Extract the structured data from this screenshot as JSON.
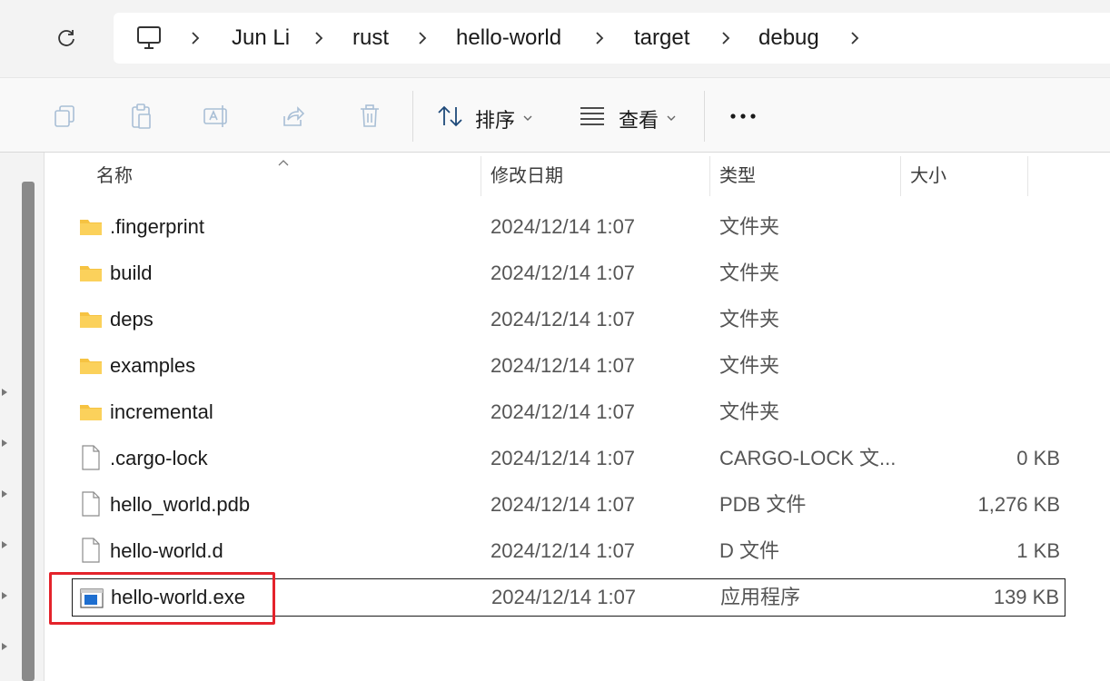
{
  "address_bar": {
    "breadcrumbs": [
      "Jun Li",
      "rust",
      "hello-world",
      "target",
      "debug"
    ]
  },
  "toolbar": {
    "sort_label": "排序",
    "view_label": "查看"
  },
  "columns": {
    "name": "名称",
    "date": "修改日期",
    "type": "类型",
    "size": "大小"
  },
  "files": [
    {
      "name": ".fingerprint",
      "date": "2024/12/14 1:07",
      "type": "文件夹",
      "size": "",
      "icon": "folder-icon"
    },
    {
      "name": "build",
      "date": "2024/12/14 1:07",
      "type": "文件夹",
      "size": "",
      "icon": "folder-icon"
    },
    {
      "name": "deps",
      "date": "2024/12/14 1:07",
      "type": "文件夹",
      "size": "",
      "icon": "folder-icon"
    },
    {
      "name": "examples",
      "date": "2024/12/14 1:07",
      "type": "文件夹",
      "size": "",
      "icon": "folder-icon"
    },
    {
      "name": "incremental",
      "date": "2024/12/14 1:07",
      "type": "文件夹",
      "size": "",
      "icon": "folder-icon"
    },
    {
      "name": ".cargo-lock",
      "date": "2024/12/14 1:07",
      "type": "CARGO-LOCK 文...",
      "size": "0 KB",
      "icon": "file-icon"
    },
    {
      "name": "hello_world.pdb",
      "date": "2024/12/14 1:07",
      "type": "PDB 文件",
      "size": "1,276 KB",
      "icon": "file-icon"
    },
    {
      "name": "hello-world.d",
      "date": "2024/12/14 1:07",
      "type": "D 文件",
      "size": "1 KB",
      "icon": "file-icon"
    },
    {
      "name": "hello-world.exe",
      "date": "2024/12/14 1:07",
      "type": "应用程序",
      "size": "139 KB",
      "icon": "exe-icon"
    }
  ],
  "highlight_color": "#e4232b",
  "folder_color": "#f6c342"
}
